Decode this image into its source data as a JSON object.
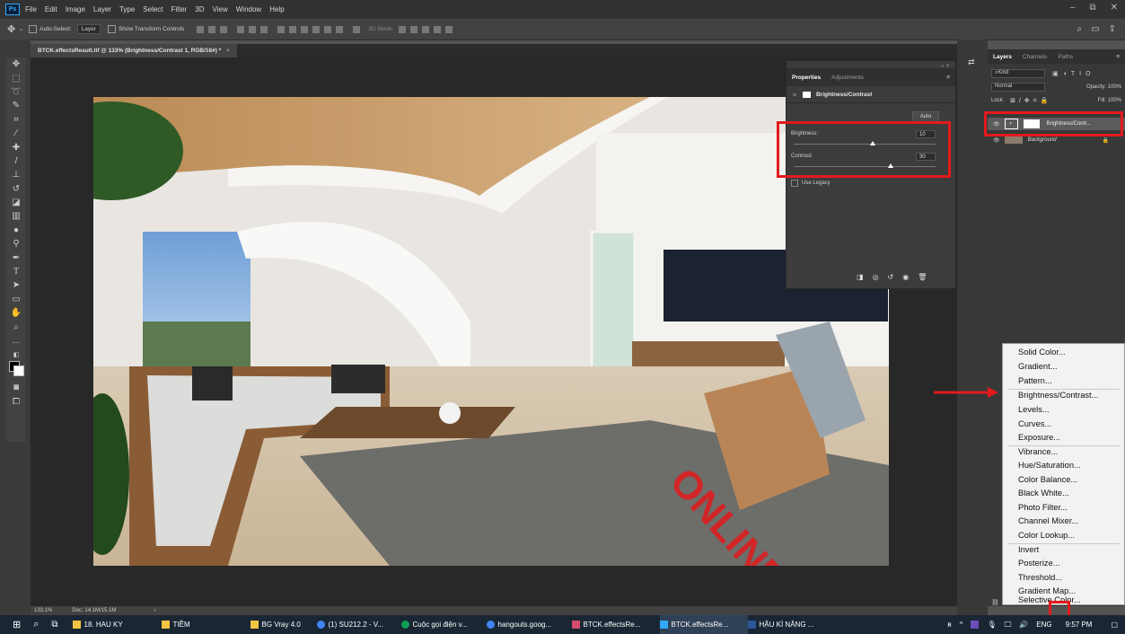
{
  "menubar": {
    "logo": "Ps",
    "items": [
      "File",
      "Edit",
      "Image",
      "Layer",
      "Type",
      "Select",
      "Filter",
      "3D",
      "View",
      "Window",
      "Help"
    ]
  },
  "options": {
    "auto_select": "Auto-Select:",
    "layer_select": "Layer",
    "transform": "Show Transform Controls",
    "mode3d": "3D Mode:"
  },
  "document": {
    "tab_title": "BTCK.effectsResult.tif @ 133% (Brightness/Contrast 1, RGB/16#) *",
    "tab_close": "×"
  },
  "status": {
    "zoom": "133.1%",
    "doc": "Doc: 14.1M/15.1M",
    "arrow": "›"
  },
  "properties": {
    "tab_properties": "Properties",
    "tab_adjustments": "Adjustments",
    "title": "Brightness/Contrast",
    "auto": "Auto",
    "brightness_label": "Brightness:",
    "brightness_value": "10",
    "contrast_label": "Contrast:",
    "contrast_value": "30",
    "legacy": "Use Legacy"
  },
  "layers": {
    "tab_layers": "Layers",
    "tab_channels": "Channels",
    "tab_paths": "Paths",
    "kind": "Kind",
    "blend": "Normal",
    "opacity": "Opacity: 100%",
    "lock": "Lock:",
    "fill": "Fill: 100%",
    "rows": [
      {
        "name": "Brightness/Contr..."
      },
      {
        "name": "Background"
      }
    ]
  },
  "adjustment_menu": {
    "groups": [
      [
        "Solid Color...",
        "Gradient...",
        "Pattern..."
      ],
      [
        "Brightness/Contrast...",
        "Levels...",
        "Curves...",
        "Exposure..."
      ],
      [
        "Vibrance...",
        "Hue/Saturation...",
        "Color Balance...",
        "Black  White...",
        "Photo Filter...",
        "Channel Mixer...",
        "Color Lookup..."
      ],
      [
        "Invert",
        "Posterize...",
        "Threshold...",
        "Gradient Map...",
        "Selective Color..."
      ]
    ]
  },
  "taskbar": {
    "items": [
      {
        "label": "18. HAU KY",
        "color": "#f4c542"
      },
      {
        "label": "TIỀM",
        "color": "#f4c542"
      },
      {
        "label": "BG Vray 4.0",
        "color": "#f4c542"
      },
      {
        "label": "(1) SU212.2 - V...",
        "color": "#4285f4"
      },
      {
        "label": "Cuộc gọi điện v...",
        "color": "#0f9d58"
      },
      {
        "label": "hangouts.goog...",
        "color": "#4285f4"
      },
      {
        "label": "BTCK.effectsRe...",
        "color": "#d34c6c"
      },
      {
        "label": "BTCK.effectsRe...",
        "color": "#31a8ff"
      },
      {
        "label": "HẬU KÌ NĂNG ...",
        "color": "#2b579a"
      }
    ],
    "lang": "ENG",
    "time": "9:57 PM"
  },
  "colors": {
    "highlight_red": "#e3191c",
    "ps_blue": "#31a8ff"
  }
}
